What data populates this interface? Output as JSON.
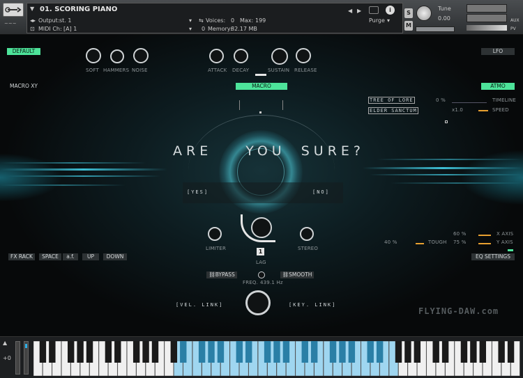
{
  "header": {
    "instrument_name": "01. SCORING PIANO",
    "output_label": "Output:",
    "output_value": "st. 1",
    "midi_label": "MIDI Ch:",
    "midi_value": "[A] 1",
    "voices_label": "Voices:",
    "voices_value": "0",
    "max_label": "Max:",
    "max_value": "199",
    "memory_value": "0",
    "memory_label": "Memory:",
    "memory_size": "82.17 MB",
    "purge_label": "Purge",
    "tune_label": "Tune",
    "tune_value": "0.00",
    "solo_label": "S",
    "mute_label": "M",
    "aux_label": "AUX",
    "pv_label": "PV"
  },
  "controls": {
    "default_label": "DEFAULT",
    "lfo_label": "LFO",
    "macro_xy_label": "MACRO XY",
    "macro_label": "MACRO",
    "atmo_label": "ATMO",
    "knob_labels": [
      "SOFT",
      "HAMMERS",
      "NOISE",
      "ATTACK",
      "DECAY",
      "SUSTAIN",
      "RELEASE"
    ],
    "tree_label": "TREE OF LORE",
    "elder_label": "ELDER SANCTUM",
    "timeline_pct": "0 %",
    "timeline_label": "TIMELINE",
    "speed_val": "x1.0",
    "speed_label": "SPEED",
    "prompt_left": "ARE",
    "prompt_mid": "YOU",
    "prompt_right": "SURE?",
    "yes_label": "[YES]",
    "no_label": "[NO]",
    "limiter_label": "LIMITER",
    "stereo_label": "STEREO",
    "lag_label": "LAG",
    "lag_value": "1",
    "fx_rack_label": "FX RACK",
    "space_label": "SPACE",
    "af_label": "a.f.",
    "up_label": "UP",
    "down_label": "DOWN",
    "tough_pct": "40 %",
    "tough_label": "TOUGH",
    "xaxis_pct": "60 %",
    "xaxis_label": "X AXIS",
    "yaxis_pct": "75 %",
    "yaxis_label": "Y AXIS",
    "eq_label": "EQ SETTINGS",
    "bypass_label": "BYPASS",
    "smooth_label": "SMOOTH",
    "freq_label": "FREQ.",
    "freq_value": "439.1 Hz",
    "vel_link_label": "[VEL. LINK]",
    "key_link_label": "[KEY. LINK]",
    "watermark": "FLYING-DAW.com"
  },
  "keyboard": {
    "octave_value": "+0"
  },
  "colors": {
    "accent_green": "#4de39a",
    "accent_orange": "#e8a030",
    "glow_cyan": "#46dcf5"
  }
}
